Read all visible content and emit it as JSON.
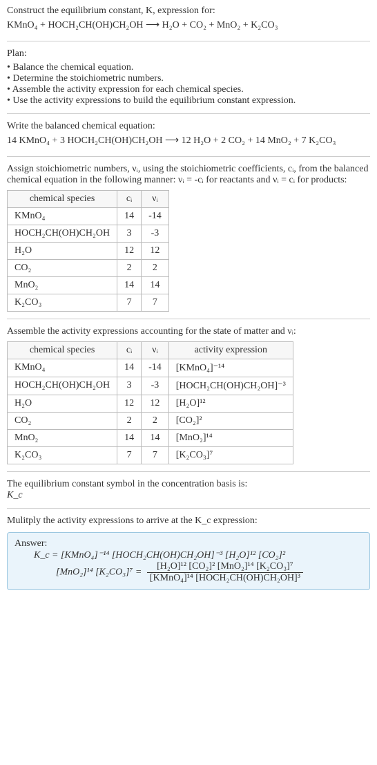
{
  "header": {
    "line1": "Construct the equilibrium constant, K, expression for:",
    "equation_lhs": "KMnO₄ + HOCH₂CH(OH)CH₂OH",
    "arrow": "⟶",
    "equation_rhs": "H₂O + CO₂ + MnO₂ + K₂CO₃"
  },
  "plan": {
    "title": "Plan:",
    "items": [
      "Balance the chemical equation.",
      "Determine the stoichiometric numbers.",
      "Assemble the activity expression for each chemical species.",
      "Use the activity expressions to build the equilibrium constant expression."
    ]
  },
  "balanced": {
    "title": "Write the balanced chemical equation:",
    "lhs": "14 KMnO₄ + 3 HOCH₂CH(OH)CH₂OH",
    "arrow": "⟶",
    "rhs": "12 H₂O + 2 CO₂ + 14 MnO₂ + 7 K₂CO₃"
  },
  "stoich": {
    "intro_a": "Assign stoichiometric numbers, νᵢ, using the stoichiometric coefficients, cᵢ, from the balanced chemical equation in the following manner: νᵢ = -cᵢ for reactants and νᵢ = cᵢ for products:",
    "headers": [
      "chemical species",
      "cᵢ",
      "νᵢ"
    ],
    "rows": [
      [
        "KMnO₄",
        "14",
        "-14"
      ],
      [
        "HOCH₂CH(OH)CH₂OH",
        "3",
        "-3"
      ],
      [
        "H₂O",
        "12",
        "12"
      ],
      [
        "CO₂",
        "2",
        "2"
      ],
      [
        "MnO₂",
        "14",
        "14"
      ],
      [
        "K₂CO₃",
        "7",
        "7"
      ]
    ]
  },
  "activity": {
    "intro": "Assemble the activity expressions accounting for the state of matter and νᵢ:",
    "headers": [
      "chemical species",
      "cᵢ",
      "νᵢ",
      "activity expression"
    ],
    "rows": [
      [
        "KMnO₄",
        "14",
        "-14",
        "[KMnO₄]⁻¹⁴"
      ],
      [
        "HOCH₂CH(OH)CH₂OH",
        "3",
        "-3",
        "[HOCH₂CH(OH)CH₂OH]⁻³"
      ],
      [
        "H₂O",
        "12",
        "12",
        "[H₂O]¹²"
      ],
      [
        "CO₂",
        "2",
        "2",
        "[CO₂]²"
      ],
      [
        "MnO₂",
        "14",
        "14",
        "[MnO₂]¹⁴"
      ],
      [
        "K₂CO₃",
        "7",
        "7",
        "[K₂CO₃]⁷"
      ]
    ]
  },
  "kc_symbol": {
    "line1": "The equilibrium constant symbol in the concentration basis is:",
    "symbol": "K_c"
  },
  "multiply": {
    "line": "Mulitply the activity expressions to arrive at the K_c expression:"
  },
  "answer": {
    "label": "Answer:",
    "line1_lhs": "K_c = [KMnO₄]⁻¹⁴ [HOCH₂CH(OH)CH₂OH]⁻³ [H₂O]¹² [CO₂]²",
    "line2_lhs": "[MnO₂]¹⁴ [K₂CO₃]⁷ = ",
    "frac_num": "[H₂O]¹² [CO₂]² [MnO₂]¹⁴ [K₂CO₃]⁷",
    "frac_den": "[KMnO₄]¹⁴ [HOCH₂CH(OH)CH₂OH]³"
  },
  "chart_data": {
    "type": "table",
    "tables": [
      {
        "title": "Stoichiometric numbers",
        "columns": [
          "chemical species",
          "c_i",
          "ν_i"
        ],
        "rows": [
          {
            "species": "KMnO4",
            "c_i": 14,
            "nu_i": -14
          },
          {
            "species": "HOCH2CH(OH)CH2OH",
            "c_i": 3,
            "nu_i": -3
          },
          {
            "species": "H2O",
            "c_i": 12,
            "nu_i": 12
          },
          {
            "species": "CO2",
            "c_i": 2,
            "nu_i": 2
          },
          {
            "species": "MnO2",
            "c_i": 14,
            "nu_i": 14
          },
          {
            "species": "K2CO3",
            "c_i": 7,
            "nu_i": 7
          }
        ]
      },
      {
        "title": "Activity expressions",
        "columns": [
          "chemical species",
          "c_i",
          "ν_i",
          "activity expression"
        ],
        "rows": [
          {
            "species": "KMnO4",
            "c_i": 14,
            "nu_i": -14,
            "activity": "[KMnO4]^-14"
          },
          {
            "species": "HOCH2CH(OH)CH2OH",
            "c_i": 3,
            "nu_i": -3,
            "activity": "[HOCH2CH(OH)CH2OH]^-3"
          },
          {
            "species": "H2O",
            "c_i": 12,
            "nu_i": 12,
            "activity": "[H2O]^12"
          },
          {
            "species": "CO2",
            "c_i": 2,
            "nu_i": 2,
            "activity": "[CO2]^2"
          },
          {
            "species": "MnO2",
            "c_i": 14,
            "nu_i": 14,
            "activity": "[MnO2]^14"
          },
          {
            "species": "K2CO3",
            "c_i": 7,
            "nu_i": 7,
            "activity": "[K2CO3]^7"
          }
        ]
      }
    ]
  }
}
